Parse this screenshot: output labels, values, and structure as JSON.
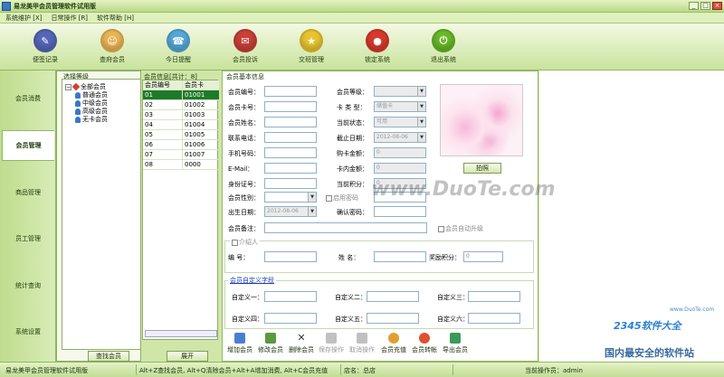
{
  "window": {
    "title": "易龙美甲会员管理软件试用版",
    "min": "_",
    "max": "□",
    "close": "×"
  },
  "menu": [
    "系统维护 [X]",
    "日常操作 [R]",
    "软件帮助 [H]"
  ],
  "toolbar": [
    {
      "label": "便签记录",
      "icon": "notepad-icon",
      "color": "#5566b8"
    },
    {
      "label": "查府会员",
      "icon": "member-search-icon",
      "color": "#e8b457"
    },
    {
      "label": "今日提醒",
      "icon": "reminder-icon",
      "color": "#55a8d8"
    },
    {
      "label": "会员投诉",
      "icon": "complaint-icon",
      "color": "#c84038"
    },
    {
      "label": "交班管理",
      "icon": "shift-icon",
      "color": "#e8c430"
    },
    {
      "label": "锁定系统",
      "icon": "lock-icon",
      "color": "#d8392c"
    },
    {
      "label": "退出系统",
      "icon": "exit-icon",
      "color": "#68b828"
    }
  ],
  "sidebar": [
    "会员消费",
    "会员管理",
    "商品管理",
    "员工管理",
    "统计查询",
    "系统设置"
  ],
  "tree": {
    "title": "选择等级",
    "root": "全部会员",
    "children": [
      "普通会员",
      "中级会员",
      "高级会员",
      "无卡会员"
    ]
  },
  "grid": {
    "title": "会员信息[共计：8]",
    "headers": [
      "会员编号",
      "会员卡"
    ],
    "rows": [
      [
        "01",
        "01001"
      ],
      [
        "02",
        "01002"
      ],
      [
        "03",
        "01003"
      ],
      [
        "04",
        "01004"
      ],
      [
        "05",
        "01005"
      ],
      [
        "06",
        "01006"
      ],
      [
        "07",
        "01007"
      ],
      [
        "08",
        "0000"
      ]
    ]
  },
  "buttons": {
    "find": "查找会员",
    "expand": "展开",
    "photo": "拍照"
  },
  "form": {
    "title": "会员基本信息",
    "labels": {
      "id": "会员编号：",
      "card": "会员卡号：",
      "name": "会员姓名：",
      "phone": "联系电话：",
      "mobile": "手机号码：",
      "email": "E-Mail：",
      "idcard": "身份证号：",
      "gender": "会员性别：",
      "birth": "出生日期：",
      "note": "会员备注：",
      "level": "会员等级：",
      "cardtype": "卡  类  型：",
      "state": "当前状态：",
      "expire": "截止日期：",
      "buybal": "购卡金额：",
      "cardbal": "卡内金额：",
      "points": "当前积分：",
      "pwd": "会员密码：",
      "confirm": "确认密码："
    },
    "values": {
      "cardtype": "储值卡",
      "state": "可用",
      "expire": "2012-08-06",
      "birth": "2012-08-06",
      "buybal": "0",
      "cardbal": "0",
      "points": "0"
    },
    "autoupgrade": "会员自动升级",
    "showpwd": "启用密码"
  },
  "introducer": {
    "title": "介绍人",
    "id": "编    号：",
    "name": "姓    名：",
    "reward": "奖励积分：",
    "reward_val": "0"
  },
  "custom": {
    "title": "会员自定义字段",
    "fields": [
      "自定义一：",
      "自定义二：",
      "自定义三：",
      "自定义四：",
      "自定义五：",
      "自定义六："
    ]
  },
  "actions": [
    {
      "label": "增加会员",
      "icon": "add-icon",
      "color": "#4a7fd0",
      "enabled": true
    },
    {
      "label": "修改会员",
      "icon": "edit-icon",
      "color": "#5a9a40",
      "enabled": true
    },
    {
      "label": "删除会员",
      "icon": "delete-icon",
      "color": "#333",
      "enabled": true
    },
    {
      "label": "保存操作",
      "icon": "save-icon",
      "color": "#aaa",
      "enabled": false
    },
    {
      "label": "取消操作",
      "icon": "cancel-icon",
      "color": "#aaa",
      "enabled": false
    },
    {
      "label": "会员充值",
      "icon": "recharge-icon",
      "color": "#e0a030",
      "enabled": true
    },
    {
      "label": "会员转帐",
      "icon": "transfer-icon",
      "color": "#e05030",
      "enabled": true
    },
    {
      "label": "导出会员",
      "icon": "export-icon",
      "color": "#3a9a5a",
      "enabled": true
    }
  ],
  "status": {
    "app": "易龙美甲会员管理软件试用版",
    "hint": "Alt+Z查找会员, Alt+Q清除会员+Alt+A增加消费, Alt+C会员充值",
    "store": "店名：总店",
    "op": "当前操作员：admin"
  },
  "watermark": {
    "duote": "www.DuoTe.com",
    "site": "www.DuoTe.com",
    "brand": "2345软件大全",
    "slogan": "国内最安全的软件站"
  }
}
